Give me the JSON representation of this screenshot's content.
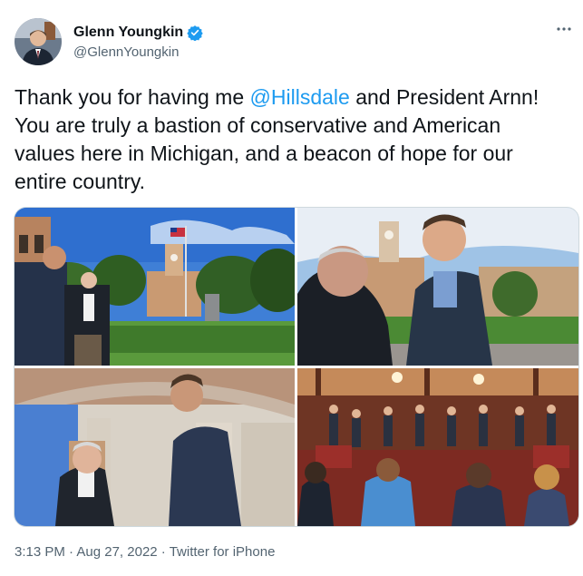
{
  "author": {
    "name": "Glenn Youngkin",
    "handle": "@GlennYoungkin",
    "verified": true,
    "avatar_icon": "profile-photo"
  },
  "tweet": {
    "text_before": "Thank you for having me ",
    "mention": "@Hillsdale",
    "text_after": " and President Arnn! You are truly a bastion of conservative and American values here in Michigan, and a beacon of hope for our entire country."
  },
  "meta": {
    "time": "3:13 PM",
    "separator": " · ",
    "date": "Aug 27, 2022",
    "source": "Twitter for iPhone"
  },
  "colors": {
    "link": "#1d9bf0",
    "verified": "#1d9bf0",
    "secondary_text": "#536471"
  },
  "icons": {
    "more": "more-horizontal-icon",
    "verified": "verified-badge-icon"
  }
}
